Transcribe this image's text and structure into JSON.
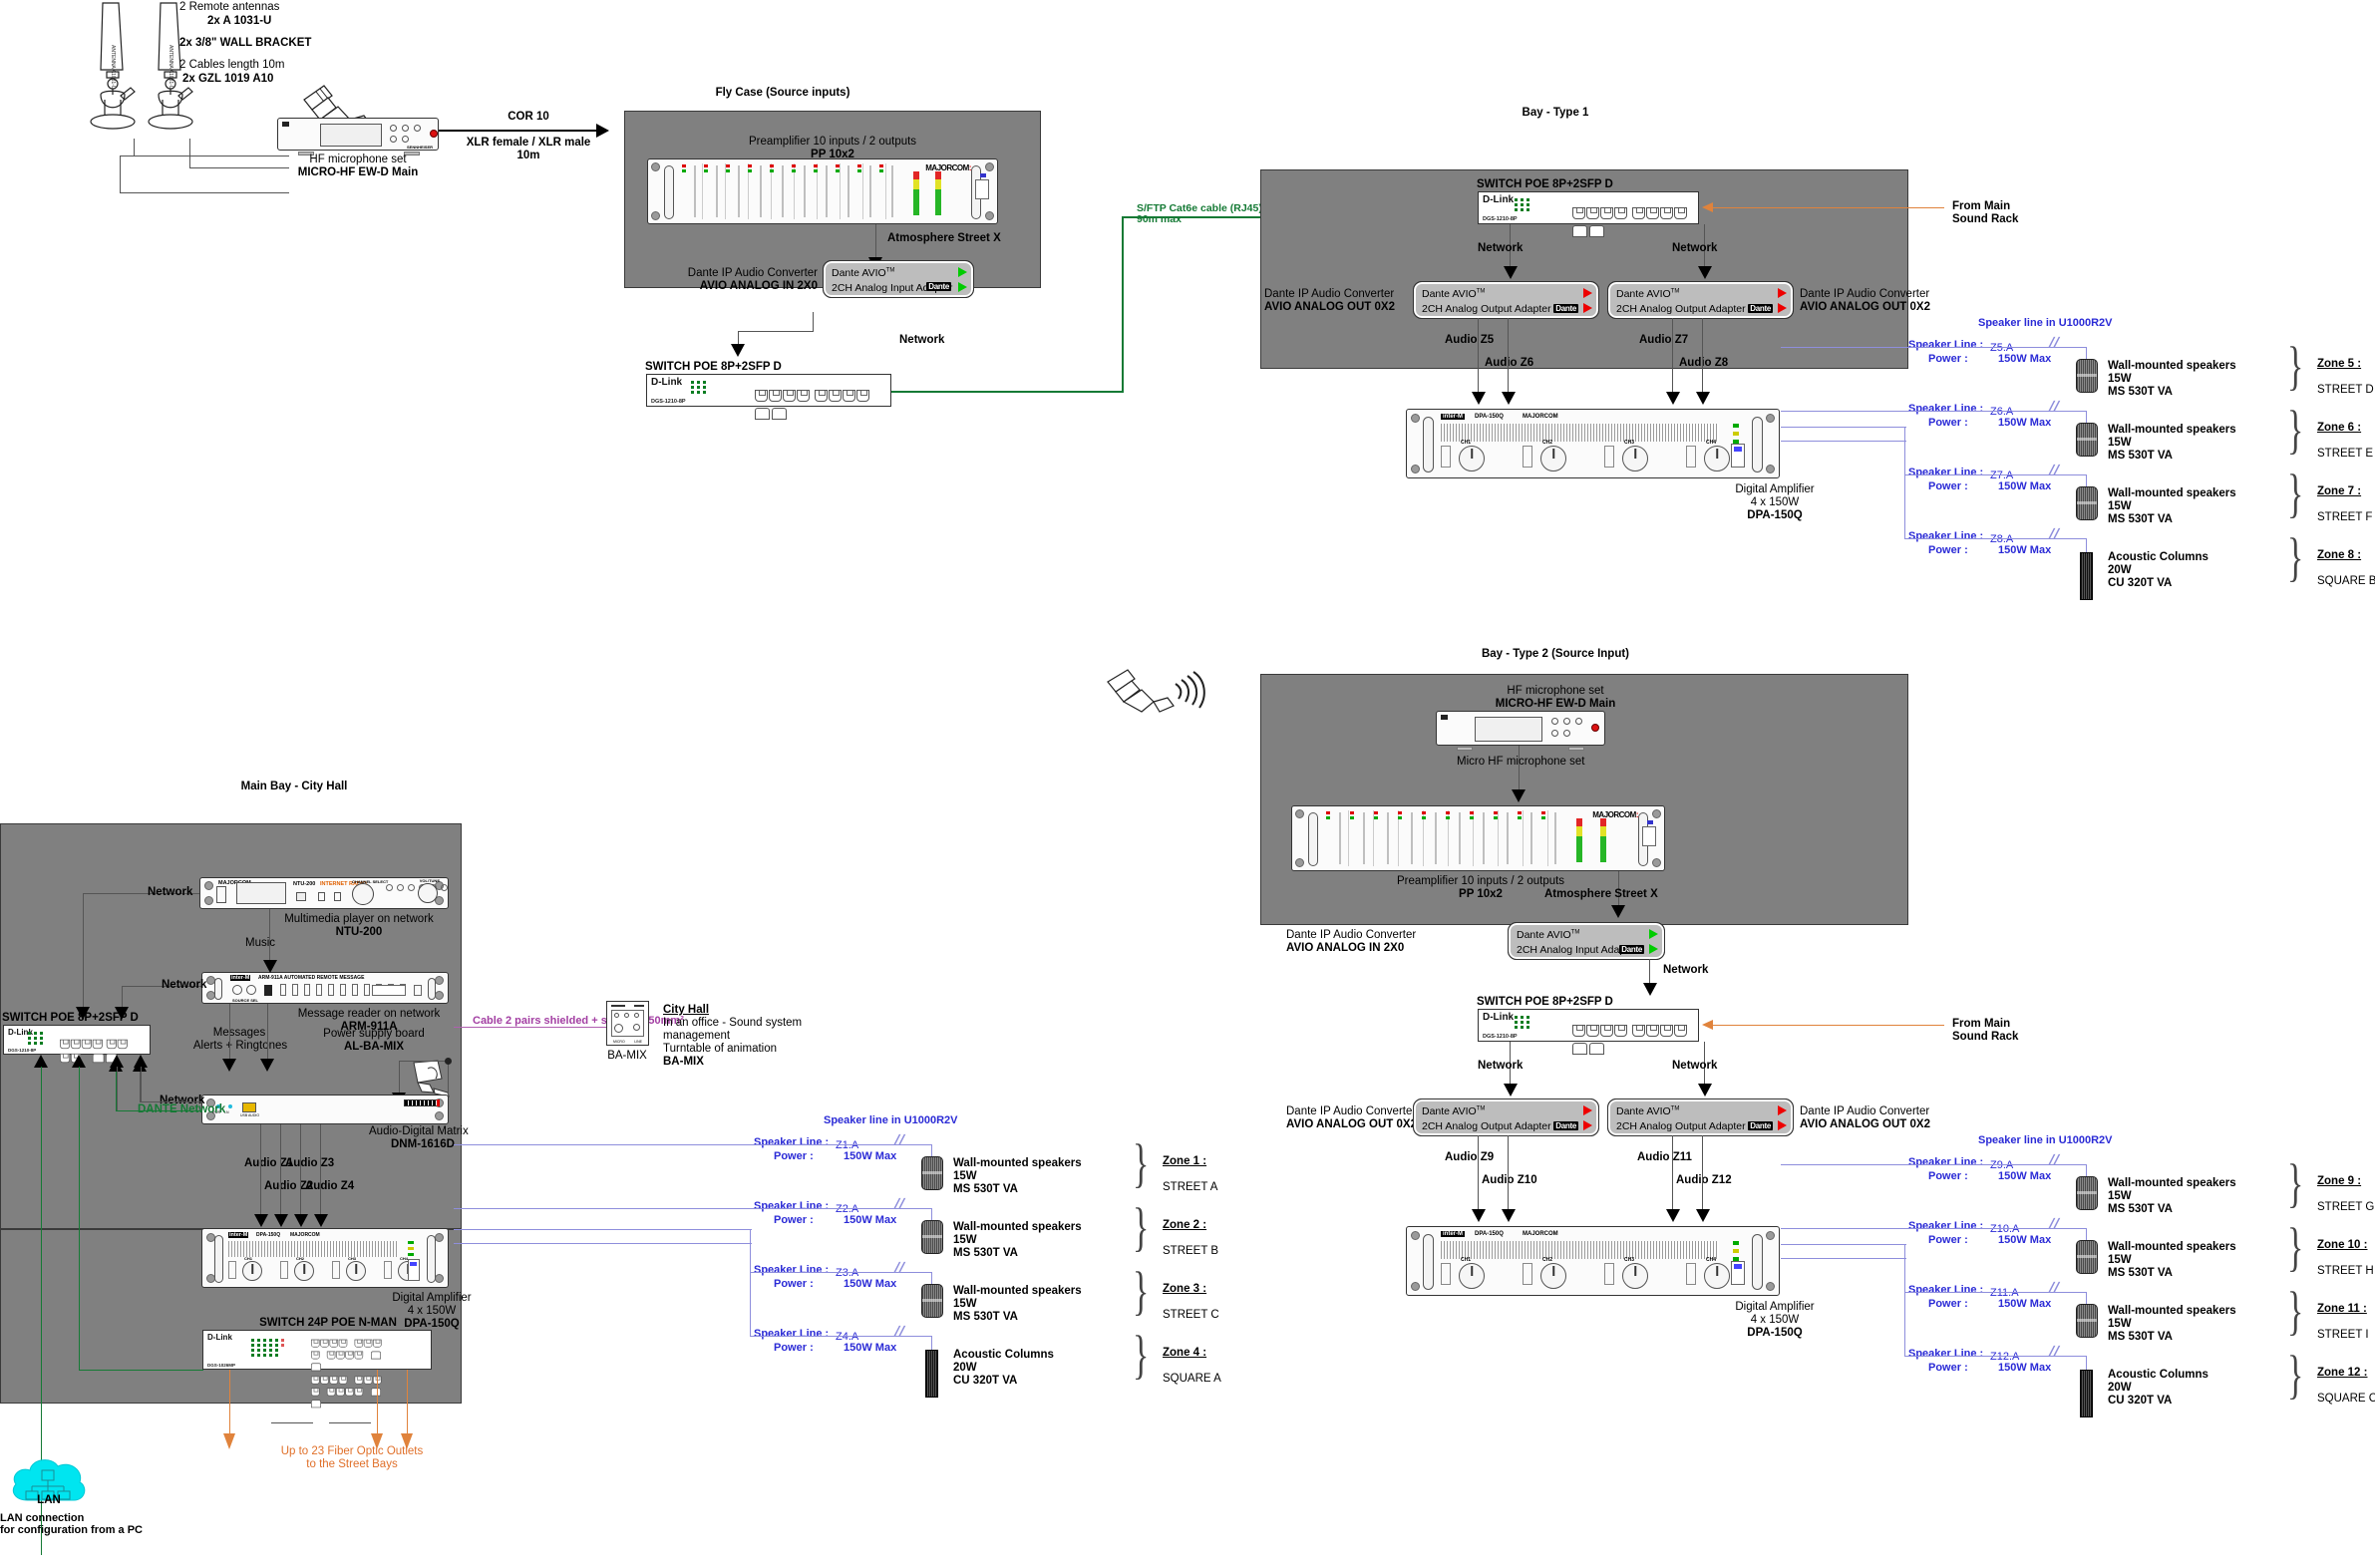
{
  "antennas": {
    "line1": "2 Remote antennas",
    "line2": "2x A 1031-U",
    "line3": "2x 3/8\" WALL BRACKET",
    "line4": "2 Cables length 10m",
    "line5": "2x GZL 1019 A10"
  },
  "hf_mic": {
    "label1": "HF microphone set",
    "label2": "MICRO-HF EW-D Main"
  },
  "cor_cable": {
    "title": "COR 10",
    "line1": "XLR female / XLR male",
    "line2": "10m"
  },
  "fly_case": {
    "title": "Fly Case (Source inputs)",
    "preamp_l1": "Preamplifier 10 inputs / 2 outputs",
    "preamp_l2": "PP 10x2",
    "preamp_brand": "MAJORCOM",
    "atmosphere": "Atmosphere Street X",
    "converter_l1": "Dante IP Audio Converter",
    "converter_l2": "AVIO ANALOG IN 2X0",
    "avio_l1": "Dante AVIO",
    "avio_tm": "TM",
    "avio_l2": "2CH Analog Input Adapter",
    "avio_brand": "Dante",
    "network": "Network",
    "switch_label": "SWITCH POE 8P+2SFP D",
    "switch_brand": "D-Link",
    "switch_model": "DGS-1210-8P"
  },
  "cat6e": {
    "line1": "S/FTP Cat6e cable (RJ45)",
    "line2": "90m max"
  },
  "bay1": {
    "title": "Bay - Type 1",
    "switch_label": "SWITCH POE 8P+2SFP D",
    "switch_brand": "D-Link",
    "switch_model": "DGS-1210-8P",
    "network": "Network",
    "conv_left_l1": "Dante IP Audio Converter",
    "conv_left_l2": "AVIO ANALOG OUT 0X2",
    "conv_right_l1": "Dante IP Audio Converter",
    "conv_right_l2": "AVIO ANALOG OUT 0X2",
    "avio_l1": "Dante AVIO",
    "avio_tm": "TM",
    "avio_l2": "2CH Analog Output Adapter",
    "avio_brand": "Dante",
    "audio_labels": [
      "Audio Z5",
      "Audio Z6",
      "Audio Z7",
      "Audio Z8"
    ],
    "amp_l1": "Digital Amplifier",
    "amp_l2": "4 x 150W",
    "amp_l3": "DPA-150Q",
    "amp_model_print": "DPA-150Q",
    "amp_brand_print": "MAJORCOM",
    "from_main_l1": "From Main",
    "from_main_l2": "Sound Rack"
  },
  "bay2": {
    "title": "Bay - Type 2 (Source Input)",
    "mic_l1": "HF microphone set",
    "mic_l2": "MICRO-HF EW-D Main",
    "micro_hf_arrow": "Micro HF microphone set",
    "preamp_l1": "Preamplifier 10 inputs / 2 outputs",
    "preamp_l2": "PP 10x2",
    "preamp_brand": "MAJORCOM",
    "atmosphere": "Atmosphere Street X",
    "conv_in_l1": "Dante IP Audio Converter",
    "conv_in_l2": "AVIO ANALOG IN 2X0",
    "avio_in_l1": "Dante AVIO",
    "avio_in_l2": "2CH Analog Input Adapter",
    "switch_label": "SWITCH POE 8P+2SFP D",
    "switch_brand": "D-Link",
    "switch_model": "DGS-1210-8P",
    "network": "Network",
    "conv_left_l1": "Dante IP Audio Converter",
    "conv_left_l2": "AVIO ANALOG OUT 0X2",
    "conv_right_l1": "Dante IP Audio Converter",
    "conv_right_l2": "AVIO ANALOG OUT 0X2",
    "avio_out_l1": "Dante AVIO",
    "avio_out_l2": "2CH Analog Output Adapter",
    "audio_labels": [
      "Audio Z9",
      "Audio Z10",
      "Audio Z11",
      "Audio Z12"
    ],
    "amp_l1": "Digital Amplifier",
    "amp_l2": "4 x 150W",
    "amp_l3": "DPA-150Q",
    "from_main_l1": "From Main",
    "from_main_l2": "Sound Rack"
  },
  "main_bay": {
    "title": "Main Bay - City Hall",
    "network": "Network",
    "dante_network": "DANTE Network",
    "ntu_l1": "Multimedia player on network",
    "ntu_l2": "NTU-200",
    "ntu_print_model": "NTU-200",
    "ntu_print_radio": "INTERNET RADIO",
    "ntu_print_brand": "MAJORCOM",
    "music": "Music",
    "arm_l1": "Message reader on network",
    "arm_l2": "ARM-911A",
    "arm_print": "ARM-911A  AUTOMATED REMOTE MESSAGE",
    "arm_brand": "inter-M",
    "messages_l1": "Messages",
    "messages_l2": "Alerts + Ringtones",
    "psu_l1": "Power supply board",
    "psu_l2": "AL-BA-MIX",
    "matrix_l1": "Audio-Digital Matrix",
    "matrix_l2": "DNM-1616D",
    "audio_labels": [
      "Audio Z1",
      "Audio Z2",
      "Audio Z3",
      "Audio Z4"
    ],
    "amp_l1": "Digital Amplifier",
    "amp_l2": "4 x 150W",
    "amp_l3": "DPA-150Q",
    "switch8_label": "SWITCH POE 8P+2SFP D",
    "switch8_brand": "D-Link",
    "switch8_model": "DGS-1210-8P",
    "switch24_label": "SWITCH 24P POE N-MAN",
    "switch24_brand": "D-Link",
    "switch24_model": "DGS-1026MP"
  },
  "bamix": {
    "cable": "Cable 2 pairs shielded + screen 0,50mm²",
    "device_label": "BA-MIX",
    "title": "City Hall",
    "l1": "In an office - Sound system",
    "l2": "management",
    "l3": "Turntable of animation",
    "l4": "BA-MIX"
  },
  "fiber": {
    "l1": "Up to 23 Fiber Optic Outlets",
    "l2": "to the Street Bays"
  },
  "lan": {
    "label": "LAN",
    "l1": "LAN connection",
    "l2": "for configuration from a PC"
  },
  "speaker_line_common": {
    "header": "Speaker line in U1000R2V",
    "prefix": "Speaker Line :",
    "power_prefix": "Power :",
    "power_value": "150W Max"
  },
  "zone_groups": [
    {
      "id": "main-bay-zones",
      "lines": [
        {
          "code": "Z1.A",
          "power": "150W Max",
          "device": {
            "type": "wall",
            "l1": "Wall-mounted speakers",
            "l2": "15W",
            "l3": "MS 530T VA"
          },
          "zone": "Zone 1 :",
          "street": "STREET A"
        },
        {
          "code": "Z2.A",
          "power": "150W Max",
          "device": {
            "type": "wall",
            "l1": "Wall-mounted speakers",
            "l2": "15W",
            "l3": "MS 530T VA"
          },
          "zone": "Zone 2 :",
          "street": "STREET B"
        },
        {
          "code": "Z3.A",
          "power": "150W Max",
          "device": {
            "type": "wall",
            "l1": "Wall-mounted speakers",
            "l2": "15W",
            "l3": "MS 530T VA"
          },
          "zone": "Zone 3 :",
          "street": "STREET C"
        },
        {
          "code": "Z4.A",
          "power": "150W Max",
          "device": {
            "type": "column",
            "l1": "Acoustic Columns",
            "l2": "20W",
            "l3": "CU 320T VA"
          },
          "zone": "Zone 4 :",
          "street": "SQUARE A"
        }
      ]
    },
    {
      "id": "bay1-zones",
      "lines": [
        {
          "code": "Z5.A",
          "power": "150W Max",
          "device": {
            "type": "wall",
            "l1": "Wall-mounted speakers",
            "l2": "15W",
            "l3": "MS 530T VA"
          },
          "zone": "Zone 5 :",
          "street": "STREET D"
        },
        {
          "code": "Z6.A",
          "power": "150W Max",
          "device": {
            "type": "wall",
            "l1": "Wall-mounted speakers",
            "l2": "15W",
            "l3": "MS 530T VA"
          },
          "zone": "Zone 6 :",
          "street": "STREET E"
        },
        {
          "code": "Z7.A",
          "power": "150W Max",
          "device": {
            "type": "wall",
            "l1": "Wall-mounted speakers",
            "l2": "15W",
            "l3": "MS 530T VA"
          },
          "zone": "Zone 7 :",
          "street": "STREET F"
        },
        {
          "code": "Z8.A",
          "power": "150W Max",
          "device": {
            "type": "column",
            "l1": "Acoustic Columns",
            "l2": "20W",
            "l3": "CU 320T VA"
          },
          "zone": "Zone 8 :",
          "street": "SQUARE B"
        }
      ]
    },
    {
      "id": "bay2-zones",
      "lines": [
        {
          "code": "Z9.A",
          "power": "150W Max",
          "device": {
            "type": "wall",
            "l1": "Wall-mounted speakers",
            "l2": "15W",
            "l3": "MS 530T VA"
          },
          "zone": "Zone 9 :",
          "street": "STREET G"
        },
        {
          "code": "Z10.A",
          "power": "150W Max",
          "device": {
            "type": "wall",
            "l1": "Wall-mounted speakers",
            "l2": "15W",
            "l3": "MS 530T VA"
          },
          "zone": "Zone 10 :",
          "street": "STREET H"
        },
        {
          "code": "Z11.A",
          "power": "150W Max",
          "device": {
            "type": "wall",
            "l1": "Wall-mounted speakers",
            "l2": "15W",
            "l3": "MS 530T VA"
          },
          "zone": "Zone 11 :",
          "street": "STREET I"
        },
        {
          "code": "Z12.A",
          "power": "150W Max",
          "device": {
            "type": "column",
            "l1": "Acoustic Columns",
            "l2": "20W",
            "l3": "CU 320T VA"
          },
          "zone": "Zone 12 :",
          "street": "SQUARE C"
        }
      ]
    }
  ],
  "colors": {
    "panel": "#808080",
    "dante_green": "#157a35",
    "speaker_blue": "#2b2bd6",
    "fiber_orange": "#e0702a",
    "bamix_pink": "#a33fa3",
    "lan_cyan": "#00e5f0"
  }
}
